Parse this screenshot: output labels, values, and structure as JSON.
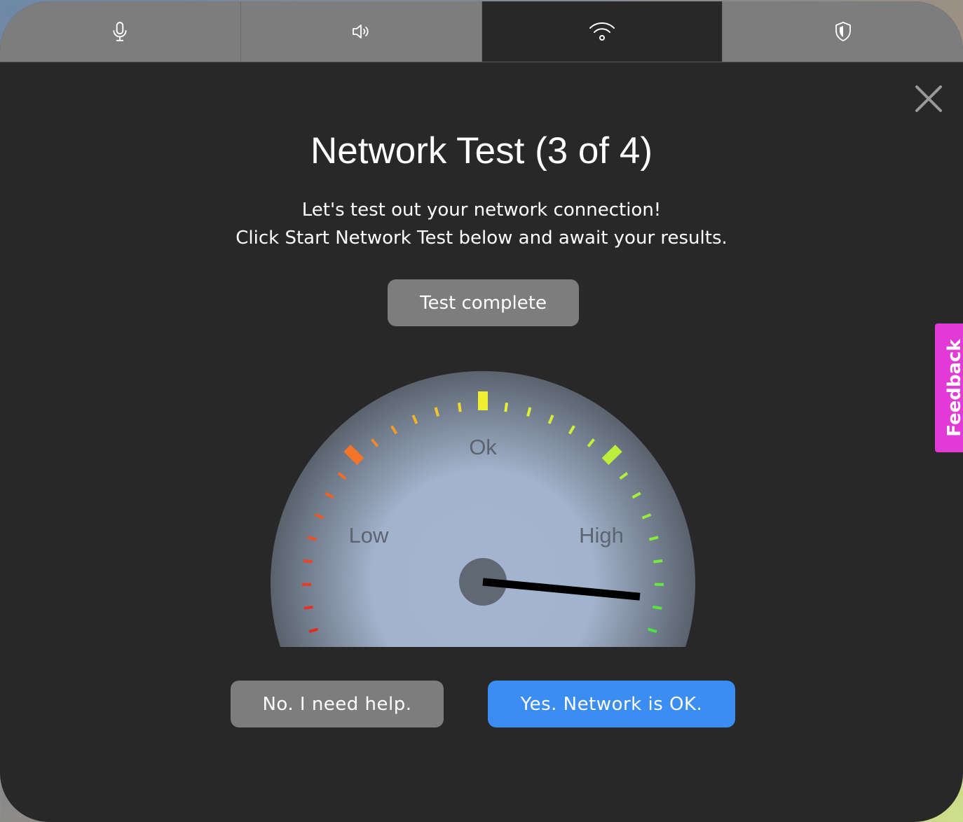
{
  "tabs": [
    {
      "icon": "microphone-icon",
      "active": false
    },
    {
      "icon": "speaker-icon",
      "active": false
    },
    {
      "icon": "wifi-icon",
      "active": true
    },
    {
      "icon": "shield-icon",
      "active": false
    }
  ],
  "header": {
    "title": "Network Test (3 of 4)",
    "description_line1": "Let's test out your network connection!",
    "description_line2": "Click Start Network Test below and await your results."
  },
  "status_button": {
    "label": "Test complete"
  },
  "gauge": {
    "labels": {
      "low": "Low",
      "ok": "Ok",
      "high": "High"
    },
    "value_fraction": 0.95
  },
  "actions": {
    "no_label": "No. I need help.",
    "yes_label": "Yes. Network is OK."
  },
  "feedback": {
    "label": "Feedback"
  },
  "colors": {
    "modal_bg": "#282828",
    "tab_bg": "#7d7d7d",
    "primary": "#3b8df2",
    "secondary": "#7d7d7d",
    "feedback": "#e23ad6"
  }
}
